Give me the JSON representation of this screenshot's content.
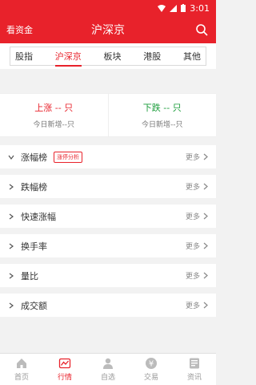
{
  "status_bar": {
    "time": "3:01"
  },
  "header": {
    "left_label": "看资金",
    "title": "沪深京"
  },
  "market_tabs": [
    {
      "label": "股指"
    },
    {
      "label": "沪深京"
    },
    {
      "label": "板块"
    },
    {
      "label": "港股"
    },
    {
      "label": "其他"
    }
  ],
  "active_tab_index": 1,
  "summary": {
    "up": {
      "label": "上涨 -- 只",
      "sub": "今日新增--只"
    },
    "down": {
      "label": "下跌 -- 只",
      "sub": "今日新增--只"
    }
  },
  "lists": [
    {
      "label": "涨幅榜",
      "badge": "涨停分析",
      "more": "更多"
    },
    {
      "label": "跌幅榜",
      "more": "更多"
    },
    {
      "label": "快速涨幅",
      "more": "更多"
    },
    {
      "label": "换手率",
      "more": "更多"
    },
    {
      "label": "量比",
      "more": "更多"
    },
    {
      "label": "成交额",
      "more": "更多"
    }
  ],
  "bottom_nav": [
    {
      "label": "首页",
      "icon": "home-icon"
    },
    {
      "label": "行情",
      "icon": "market-chart-icon"
    },
    {
      "label": "自选",
      "icon": "user-icon"
    },
    {
      "label": "交易",
      "icon": "yen-icon"
    },
    {
      "label": "资讯",
      "icon": "news-icon"
    }
  ],
  "colors": {
    "brand_red": "#e8222b",
    "down_green": "#1a9c3a"
  }
}
